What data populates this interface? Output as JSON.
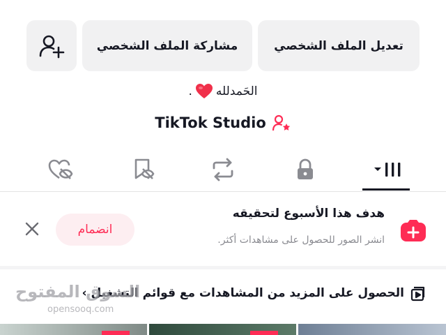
{
  "profile": {
    "stats_cutoff": [
      "",
      "",
      ""
    ]
  },
  "actions": {
    "edit_label": "تعديل الملف الشخصي",
    "share_label": "مشاركة الملف الشخصي"
  },
  "bio": {
    "text": "الحَمدلله",
    "trailing": "."
  },
  "studio": {
    "label": "TikTok Studio"
  },
  "tabs": [
    {
      "name": "videos",
      "icon": "grid-icon"
    },
    {
      "name": "private",
      "icon": "lock-icon"
    },
    {
      "name": "reposts",
      "icon": "repost-icon"
    },
    {
      "name": "favorites",
      "icon": "bookmark-hidden-icon"
    },
    {
      "name": "liked",
      "icon": "heart-hidden-icon"
    }
  ],
  "goal": {
    "title": "هدف هذا الأسبوع لتحقيقه",
    "subtitle": "انشر الصور للحصول على مشاهدات أكثر.",
    "join_label": "انضمام"
  },
  "promo": {
    "text": "الحصول على المزيد من المشاهدات مع قوائم التشغيل ›"
  },
  "watermark": {
    "arabic": "السوق المفتوح",
    "latin": "opensooq.com"
  },
  "colors": {
    "accent": "#fe2c55",
    "text": "#161823",
    "muted": "#8a8b91",
    "button_bg": "#f1f1f2"
  }
}
